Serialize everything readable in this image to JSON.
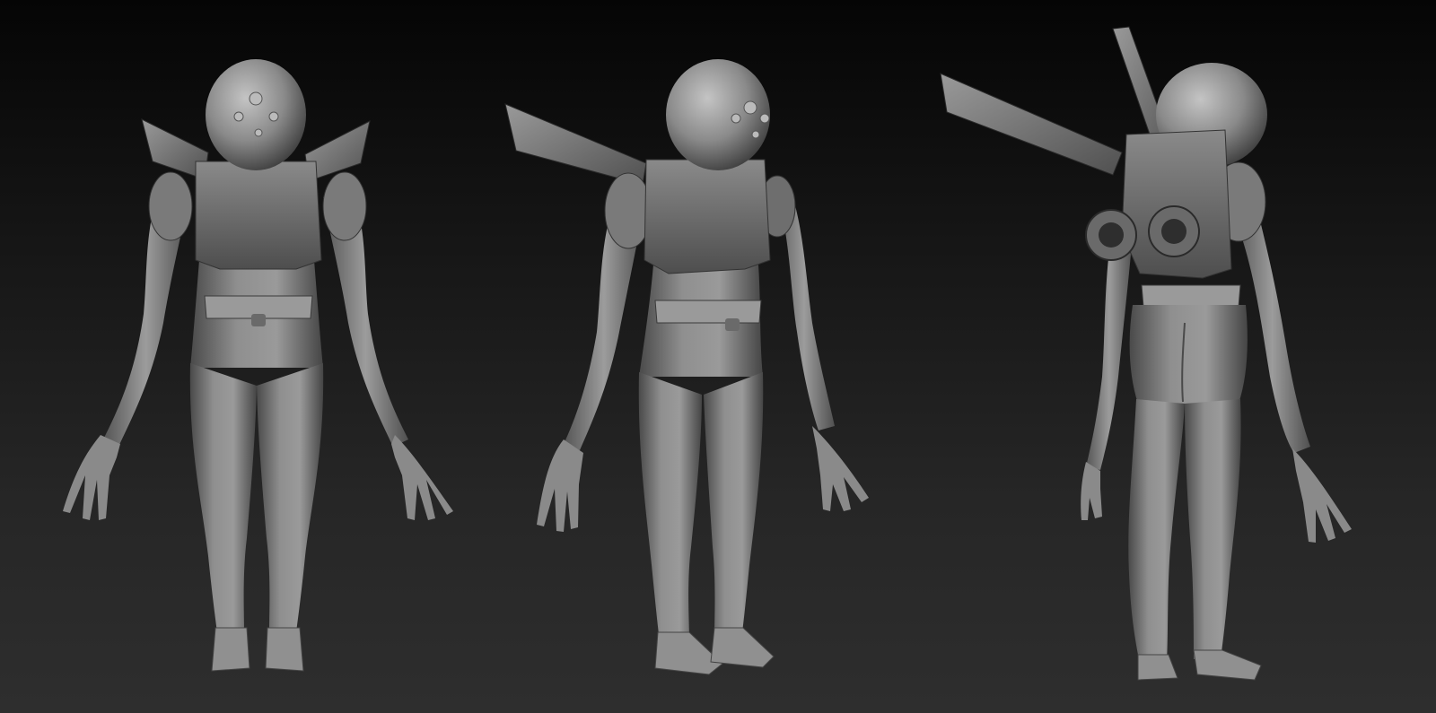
{
  "scene": {
    "subject": "alien-sculpt-turnaround",
    "views": [
      {
        "name": "front-view"
      },
      {
        "name": "three-quarter-view"
      },
      {
        "name": "back-view"
      }
    ],
    "colors": {
      "background_top": "#050505",
      "background_bottom": "#2e2e2e",
      "clay_light": "#a8a8a8",
      "clay_mid": "#7a7a7a",
      "clay_dark": "#3e3e3e"
    }
  }
}
